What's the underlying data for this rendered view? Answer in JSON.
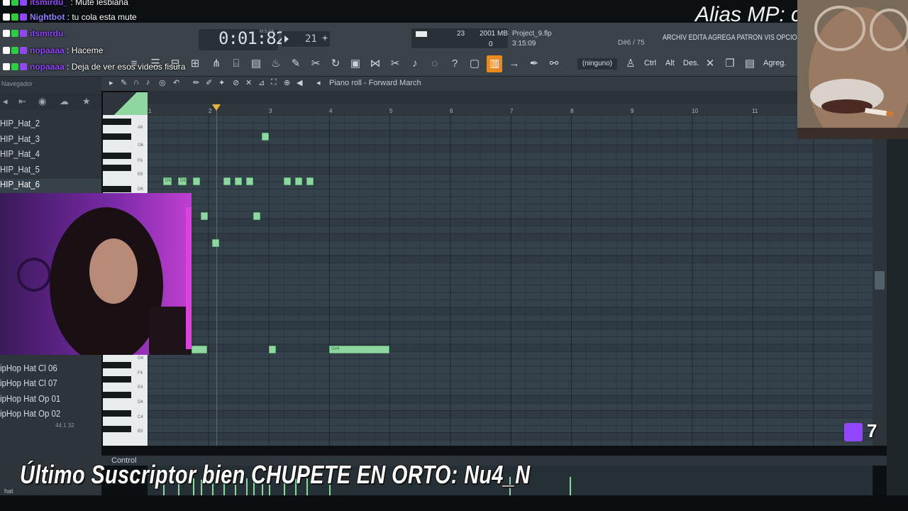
{
  "chat": [
    {
      "user": "itsmirdu_",
      "sep": " : ",
      "text": "Mute lesbiana",
      "color": "#9146ff"
    },
    {
      "user": "Nightbot",
      "sep": " : ",
      "text": "tu cola esta mute",
      "color": "#8f7cff"
    },
    {
      "user": "itsmirdu_",
      "sep": "",
      "text": "",
      "color": "#9146ff"
    },
    {
      "user": "nopaaaa",
      "sep": " : ",
      "text": "Haceme",
      "color": "#9146ff"
    },
    {
      "user": "nopaaaa",
      "sep": " : ",
      "text": "Deja de ver esos videos fisura",
      "color": "#9146ff"
    }
  ],
  "alias_overlay": "Alias MP: c",
  "toolbar": {
    "time": "0:01:82",
    "time_unit": "M:S:CS",
    "tempo": "21",
    "cpu": "23",
    "ram": "2001 MB",
    "poly": "0",
    "project_name": "Project_9.flp",
    "project_time": "3:15:09",
    "note_position": "D#6 / 75",
    "menu_strip": "ARCHIV EDITA AGREGA PATRON VIS OPCIONES",
    "snap": "(ninguno)",
    "ctrl_label": "Ctrl",
    "alt_label": "Alt",
    "des_label": "Des.",
    "agreg_label": "Agreg."
  },
  "piano_roll": {
    "title": "Piano roll - Forward March",
    "ruler": [
      "1",
      "2",
      "3",
      "4",
      "5",
      "6",
      "7",
      "8",
      "9",
      "10",
      "11"
    ],
    "key_labels": [
      "A6",
      "G6",
      "F6",
      "E6",
      "D6",
      "G4",
      "F4",
      "E4",
      "D4",
      "C4",
      "B3"
    ],
    "notes": [
      {
        "label": ""
      },
      {
        "label": "D6"
      },
      {
        "label": "D6"
      },
      {
        "label": ""
      },
      {
        "label": ""
      },
      {
        "label": ""
      },
      {
        "label": ""
      },
      {
        "label": ""
      },
      {
        "label": ""
      },
      {
        "label": ""
      },
      {
        "label": ""
      },
      {
        "label": ""
      },
      {
        "label": ""
      },
      {
        "label": ""
      },
      {
        "label": "G#4"
      },
      {
        "label": ""
      },
      {
        "label": "G#4"
      }
    ],
    "control_label": "Control"
  },
  "browser": {
    "title": "Navegador",
    "items_top": [
      "HIP_Hat_2",
      "HIP_Hat_3",
      "HIP_Hat_4",
      "HIP_Hat_5",
      "HIP_Hat_6"
    ],
    "items_bottom": [
      "ipHop Hat Cl 06",
      "ipHop Hat Cl 07",
      "ipHop Hat Op 01",
      "ipHop Hat Op 02"
    ],
    "sample_info": "44.1 32",
    "search": "hat"
  },
  "subscriber_banner": "Último Suscriptor bien CHUPETE EN ORTO: Nu4_N",
  "twitch_count": "7",
  "colors": {
    "accent": "#e98a22",
    "note": "#8fd7a0",
    "twitch": "#9146ff"
  }
}
